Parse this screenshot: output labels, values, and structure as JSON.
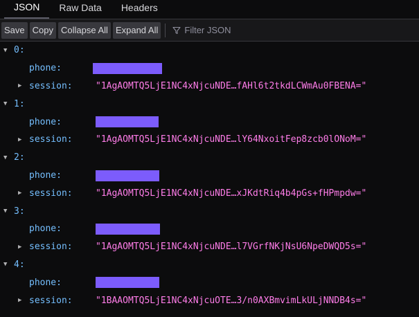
{
  "tabs": [
    {
      "label": "JSON",
      "active": true
    },
    {
      "label": "Raw Data",
      "active": false
    },
    {
      "label": "Headers",
      "active": false
    }
  ],
  "toolbar": {
    "save": "Save",
    "copy": "Copy",
    "collapse_all": "Collapse All",
    "expand_all": "Expand All",
    "filter_placeholder": "Filter JSON",
    "filter_icon": "funnel-icon"
  },
  "entries": [
    {
      "index": "0:",
      "phone_key": "phone:",
      "session_key": "session:",
      "session": "\"1AgAOMTQ5LjE1NC4xNjcuNDE…fAHl6t2tkdLCWmAu0FBENA=\""
    },
    {
      "index": "1:",
      "phone_key": "phone:",
      "session_key": "session:",
      "session": "\"1AgAOMTQ5LjE1NC4xNjcuNDE…lY64NxoitFep8zcb0lONoM=\""
    },
    {
      "index": "2:",
      "phone_key": "phone:",
      "session_key": "session:",
      "session": "\"1AgAOMTQ5LjE1NC4xNjcuNDE…xJKdtRiq4b4pGs+fHPmpdw=\""
    },
    {
      "index": "3:",
      "phone_key": "phone:",
      "session_key": "session:",
      "session": "\"1AgAOMTQ5LjE1NC4xNjcuNDE…l7VGrfNKjNsU6NpeDWQD5s=\""
    },
    {
      "index": "4:",
      "phone_key": "phone:",
      "session_key": "session:",
      "session": "\"1BAAOMTQ5LjE1NC4xNjcuOTE…3/n0AXBmvimLkULjNNDB4s=\""
    }
  ],
  "colors": {
    "redaction": "#7c5cfc",
    "key": "#75bfff",
    "string": "#ff7de9"
  },
  "icons": {
    "expanded": "triangle-down-icon",
    "collapsed": "triangle-right-icon"
  }
}
